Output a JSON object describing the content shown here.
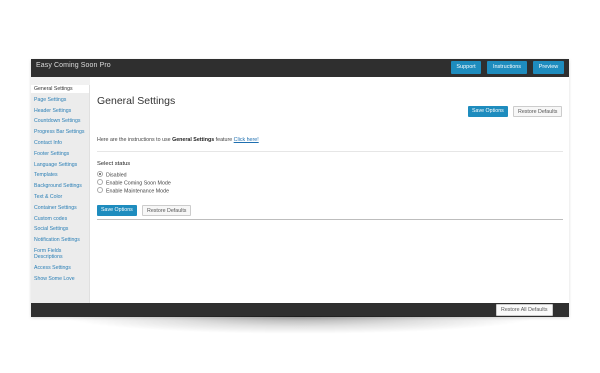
{
  "app": {
    "title": "Easy Coming Soon Pro"
  },
  "topbar": {
    "support": "Support",
    "instructions": "Instructions",
    "preview": "Preview"
  },
  "sidebar": {
    "items": [
      {
        "label": "General Settings",
        "active": true
      },
      {
        "label": "Page Settings"
      },
      {
        "label": "Header Settings"
      },
      {
        "label": "Countdown Settings"
      },
      {
        "label": "Progress Bar Settings"
      },
      {
        "label": "Contact Info"
      },
      {
        "label": "Footer Settings"
      },
      {
        "label": "Language Settings"
      },
      {
        "label": "Templates"
      },
      {
        "label": "Background Settings"
      },
      {
        "label": "Text & Color"
      },
      {
        "label": "Container Settings"
      },
      {
        "label": "Custom codes"
      },
      {
        "label": "Social Settings"
      },
      {
        "label": "Notification Settings"
      },
      {
        "label": "Form Fields Descriptions"
      },
      {
        "label": "Access Settings"
      },
      {
        "label": "Show Some Love"
      }
    ]
  },
  "main": {
    "title": "General Settings",
    "save_options": "Save Options",
    "restore_defaults": "Restore Defaults",
    "intro_prefix": "Here are the instructions to use",
    "intro_bold": "General Settings",
    "intro_middle": "feature",
    "intro_link": "Click here!",
    "status_label": "Select status",
    "status_options": [
      {
        "label": "Disabled",
        "selected": true
      },
      {
        "label": "Enable Coming Soon Mode",
        "selected": false
      },
      {
        "label": "Enable Maintenance Mode",
        "selected": false
      }
    ]
  },
  "footer": {
    "restore_all": "Restore All Defaults"
  },
  "colors": {
    "accent": "#1e8cbe",
    "topbar": "#2f2f2f",
    "link": "#2a7fb6"
  }
}
